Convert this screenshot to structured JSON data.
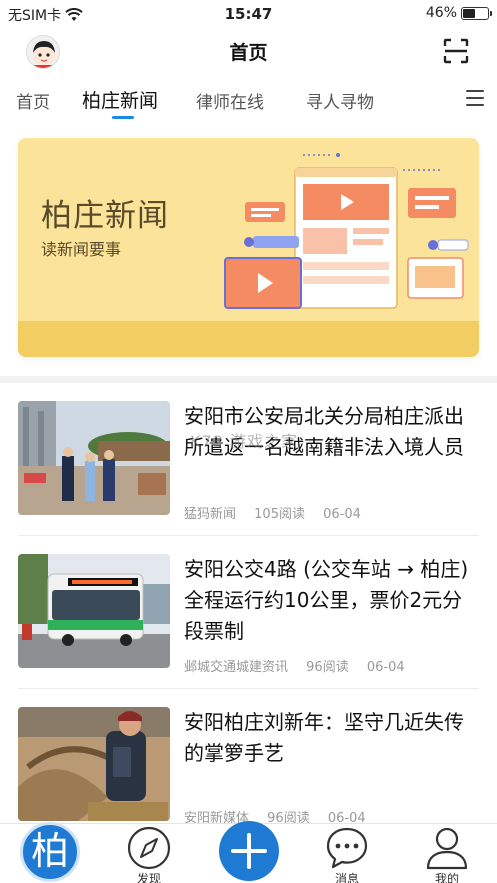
{
  "status_bar": {
    "carrier": "无SIM卡",
    "time": "15:47",
    "battery": "46%"
  },
  "header": {
    "title": "首页"
  },
  "tabs": [
    {
      "label": "首页"
    },
    {
      "label": "柏庄新闻"
    },
    {
      "label": "律师在线"
    },
    {
      "label": "寻人寻物"
    }
  ],
  "banner": {
    "title": "柏庄新闻",
    "subtitle": "读新闻要事"
  },
  "watermark": "K73 游戏之家",
  "news": [
    {
      "title": "安阳市公安局北关分局柏庄派出所遣返一名越南籍非法入境人员",
      "source": "猛犸新闻",
      "reads": "105阅读",
      "date": "06-04"
    },
    {
      "title": "安阳公交4路 (公交车站 → 柏庄) 全程运行约10公里，票价2元分段票制",
      "source": "邺城交通城建资讯",
      "reads": "96阅读",
      "date": "06-04"
    },
    {
      "title": "安阳柏庄刘新年：坚守几近失传的掌箩手艺",
      "source": "安阳新媒体",
      "reads": "96阅读",
      "date": "06-04"
    }
  ],
  "bottom_nav": {
    "home_char": "柏",
    "items": [
      {
        "label": "发现"
      },
      {
        "label": "消息"
      },
      {
        "label": "我的"
      }
    ]
  }
}
